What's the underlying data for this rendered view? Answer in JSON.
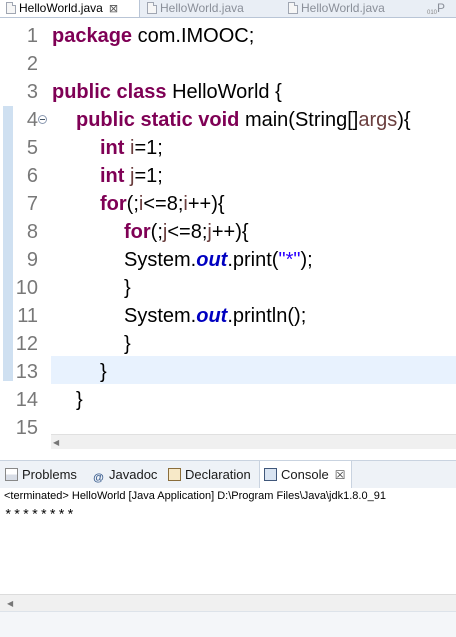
{
  "editor_tabs": [
    {
      "label": "HelloWorld.java",
      "active": true
    },
    {
      "label": "HelloWorld.java",
      "active": false
    },
    {
      "label": "HelloWorld.java",
      "active": false
    },
    {
      "label": "P",
      "active": false
    }
  ],
  "tab_close_glyph": "⊠",
  "package_icon_text": "010",
  "editor": {
    "lines": [
      {
        "num": "1",
        "indent": 0,
        "tokens": [
          {
            "t": "package",
            "c": "kw"
          },
          {
            "t": " com.IMOOC;",
            "c": ""
          }
        ]
      },
      {
        "num": "2",
        "indent": 0,
        "tokens": []
      },
      {
        "num": "3",
        "indent": 0,
        "tokens": [
          {
            "t": "public",
            "c": "kw"
          },
          {
            "t": " ",
            "c": ""
          },
          {
            "t": "class",
            "c": "kw"
          },
          {
            "t": " HelloWorld {",
            "c": ""
          }
        ]
      },
      {
        "num": "4",
        "indent": 1,
        "fold": true,
        "tokens": [
          {
            "t": "public",
            "c": "kw"
          },
          {
            "t": " ",
            "c": ""
          },
          {
            "t": "static",
            "c": "kw"
          },
          {
            "t": " ",
            "c": ""
          },
          {
            "t": "void",
            "c": "kw"
          },
          {
            "t": " main(String[]",
            "c": ""
          },
          {
            "t": "args",
            "c": "var"
          },
          {
            "t": "){",
            "c": ""
          }
        ]
      },
      {
        "num": "5",
        "indent": 2,
        "tokens": [
          {
            "t": "int",
            "c": "kw"
          },
          {
            "t": " ",
            "c": ""
          },
          {
            "t": "i",
            "c": "var"
          },
          {
            "t": "=1;",
            "c": ""
          }
        ]
      },
      {
        "num": "6",
        "indent": 2,
        "tokens": [
          {
            "t": "int",
            "c": "kw"
          },
          {
            "t": " ",
            "c": ""
          },
          {
            "t": "j",
            "c": "var"
          },
          {
            "t": "=1;",
            "c": ""
          }
        ]
      },
      {
        "num": "7",
        "indent": 2,
        "tokens": [
          {
            "t": "for",
            "c": "kw"
          },
          {
            "t": "(;",
            "c": ""
          },
          {
            "t": "i",
            "c": "var"
          },
          {
            "t": "<=8;",
            "c": ""
          },
          {
            "t": "i",
            "c": "var"
          },
          {
            "t": "++){",
            "c": ""
          }
        ]
      },
      {
        "num": "8",
        "indent": 3,
        "tokens": [
          {
            "t": "for",
            "c": "kw"
          },
          {
            "t": "(;",
            "c": ""
          },
          {
            "t": "j",
            "c": "var"
          },
          {
            "t": "<=8;",
            "c": ""
          },
          {
            "t": "j",
            "c": "var"
          },
          {
            "t": "++){",
            "c": ""
          }
        ]
      },
      {
        "num": "9",
        "indent": 3,
        "tokens": [
          {
            "t": "System.",
            "c": ""
          },
          {
            "t": "out",
            "c": "fld"
          },
          {
            "t": ".print(",
            "c": ""
          },
          {
            "t": "\"*\"",
            "c": "str"
          },
          {
            "t": ");",
            "c": ""
          }
        ]
      },
      {
        "num": "10",
        "indent": 3,
        "tokens": [
          {
            "t": "}",
            "c": ""
          }
        ]
      },
      {
        "num": "11",
        "indent": 3,
        "tokens": [
          {
            "t": "System.",
            "c": ""
          },
          {
            "t": "out",
            "c": "fld"
          },
          {
            "t": ".println();",
            "c": ""
          }
        ]
      },
      {
        "num": "12",
        "indent": 3,
        "tokens": [
          {
            "t": "}",
            "c": ""
          }
        ]
      },
      {
        "num": "13",
        "indent": 2,
        "tokens": [
          {
            "t": "}",
            "c": ""
          }
        ]
      },
      {
        "num": "14",
        "indent": 1,
        "tokens": [
          {
            "t": "}",
            "c": ""
          }
        ]
      },
      {
        "num": "15",
        "indent": 0,
        "tokens": []
      }
    ]
  },
  "views": {
    "tabs": [
      {
        "label": "Problems",
        "icon": "problems-icon",
        "active": false
      },
      {
        "label": "Javadoc",
        "icon": "javadoc-icon",
        "active": false
      },
      {
        "label": "Declaration",
        "icon": "declaration-icon",
        "active": false
      },
      {
        "label": "Console",
        "icon": "console-icon",
        "active": true
      }
    ],
    "javadoc_glyph": "@",
    "console_close_glyph": "☒"
  },
  "console": {
    "status": "<terminated> HelloWorld [Java Application] D:\\Program Files\\Java\\jdk1.8.0_91",
    "output": "********"
  },
  "scroll_arrow_glyph": "◀",
  "colors": {
    "keyword": "#7f0055",
    "variable": "#6a3e3e",
    "string": "#2a00ff",
    "field": "#0000c0",
    "current_line": "#e8f2fe"
  }
}
